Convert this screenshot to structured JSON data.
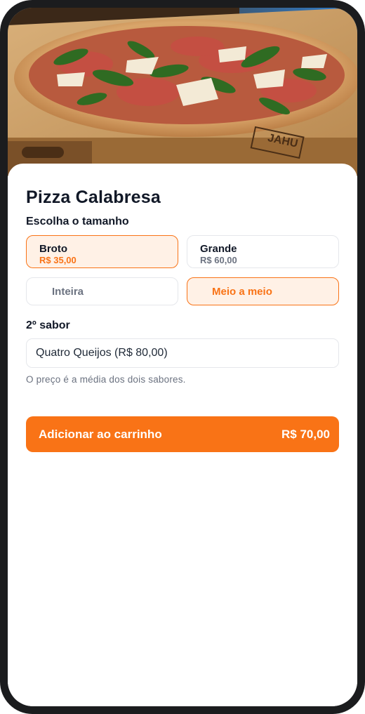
{
  "product": {
    "title": "Pizza Calabresa",
    "image_alt": "pizza"
  },
  "size_section": {
    "label": "Escolha o tamanho",
    "options": [
      {
        "name": "Broto",
        "price": "R$ 35,00",
        "selected": true
      },
      {
        "name": "Grande",
        "price": "R$ 60,00",
        "selected": false
      }
    ]
  },
  "mode": {
    "options": [
      {
        "label": "Inteira",
        "selected": false
      },
      {
        "label": "Meio a meio",
        "selected": true
      }
    ]
  },
  "second_flavor": {
    "label": "2º sabor",
    "value": "Quatro Queijos (R$ 80,00)",
    "hint": "O preço é a média dos dois sabores."
  },
  "cart": {
    "label": "Adicionar ao carrinho",
    "total": "R$ 70,00"
  },
  "colors": {
    "accent": "#f97316",
    "accent_bg": "#fff1e6",
    "text": "#111827",
    "muted": "#6b7280",
    "border": "#e5e7eb"
  },
  "hero": {
    "board_logo": "JAHU"
  }
}
